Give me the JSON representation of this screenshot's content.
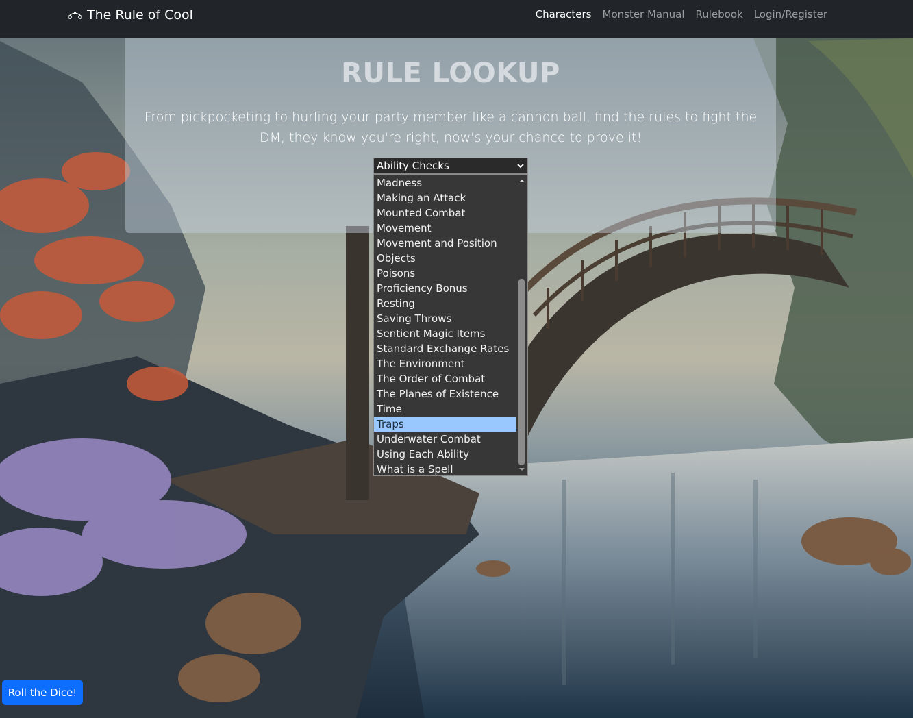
{
  "navbar": {
    "brand": "The Rule of Cool",
    "brand_icon": "dice-arc-icon",
    "links": [
      {
        "label": "Characters",
        "active": true
      },
      {
        "label": "Monster Manual",
        "active": false
      },
      {
        "label": "Rulebook",
        "active": false
      },
      {
        "label": "Login/Register",
        "active": false
      }
    ]
  },
  "hero": {
    "title": "RULE LOOKUP",
    "subtitle": "From pickpocketing to hurling your party member like a cannon ball, find the rules to fight the DM, they know you're right, now's your chance to prove it!"
  },
  "rule_select": {
    "value": "Ability Checks",
    "options_visible": [
      "Madness",
      "Making an Attack",
      "Mounted Combat",
      "Movement",
      "Movement and Position",
      "Objects",
      "Poisons",
      "Proficiency Bonus",
      "Resting",
      "Saving Throws",
      "Sentient Magic Items",
      "Standard Exchange Rates",
      "The Environment",
      "The Order of Combat",
      "The Planes of Existence",
      "Time",
      "Traps",
      "Underwater Combat",
      "Using Each Ability",
      "What is a Spell"
    ],
    "highlighted": "Traps"
  },
  "roll_button": {
    "label": "Roll the Dice!"
  },
  "colors": {
    "navbar_bg": "#212529",
    "primary": "#0d6efd",
    "option_highlight": "#99c8ff",
    "dropdown_bg": "#373737"
  }
}
